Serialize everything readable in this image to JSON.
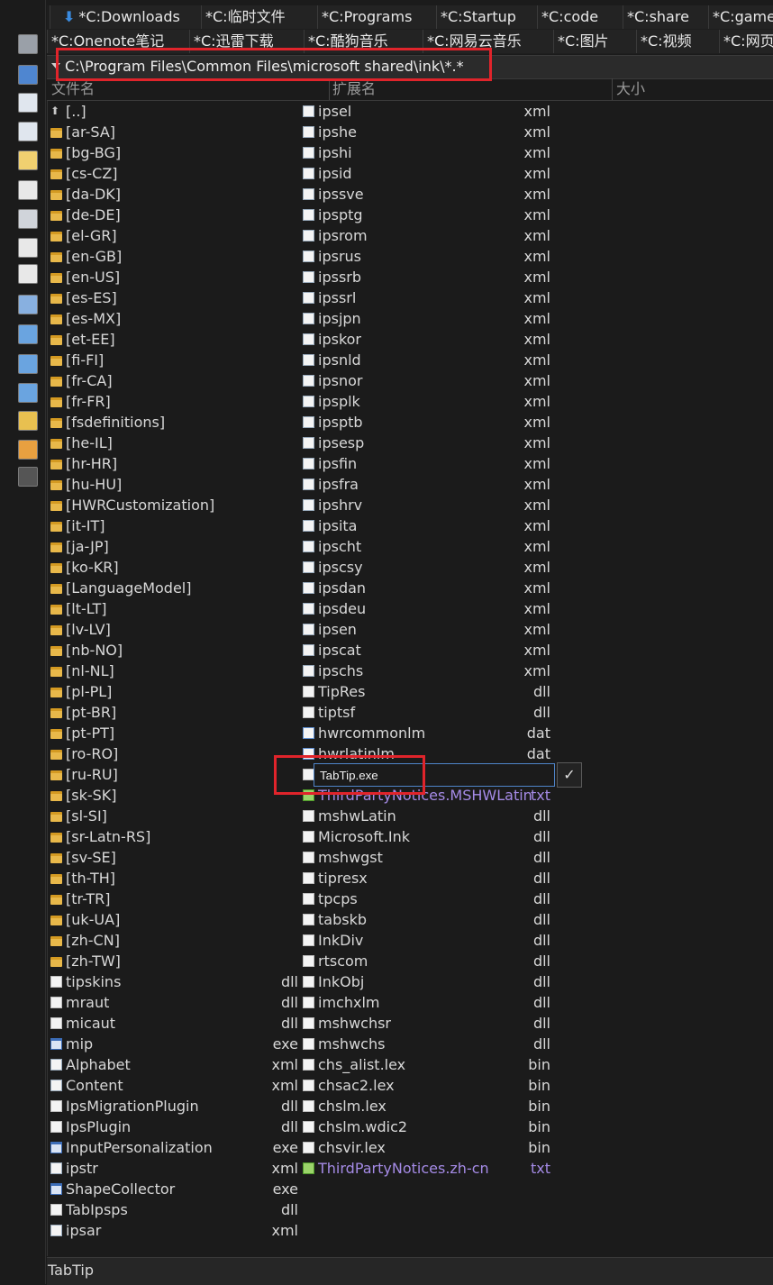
{
  "tabs_row1": [
    {
      "label": "*C:Downloads",
      "icon": "download-arrow-icon"
    },
    {
      "label": "*C:临时文件"
    },
    {
      "label": "*C:Programs"
    },
    {
      "label": "*C:Startup"
    },
    {
      "label": "*C:code"
    },
    {
      "label": "*C:share"
    },
    {
      "label": "*C:game"
    }
  ],
  "tabs_row2": [
    {
      "label": "*C:Onenote笔记"
    },
    {
      "label": "*C:迅雷下载"
    },
    {
      "label": "*C:酷狗音乐"
    },
    {
      "label": "*C:网易云音乐"
    },
    {
      "label": "*C:图片"
    },
    {
      "label": "*C:视频"
    },
    {
      "label": "*C:网页"
    }
  ],
  "path": "C:\\Program Files\\Common Files\\microsoft shared\\ink\\*.*",
  "columns": {
    "name": "文件名",
    "ext": "扩展名",
    "size": "大小"
  },
  "left_column": [
    {
      "name": "[..]",
      "ext": "",
      "icon": "up"
    },
    {
      "name": "[ar-SA]",
      "ext": "",
      "icon": "folder"
    },
    {
      "name": "[bg-BG]",
      "ext": "",
      "icon": "folder"
    },
    {
      "name": "[cs-CZ]",
      "ext": "",
      "icon": "folder"
    },
    {
      "name": "[da-DK]",
      "ext": "",
      "icon": "folder"
    },
    {
      "name": "[de-DE]",
      "ext": "",
      "icon": "folder"
    },
    {
      "name": "[el-GR]",
      "ext": "",
      "icon": "folder"
    },
    {
      "name": "[en-GB]",
      "ext": "",
      "icon": "folder"
    },
    {
      "name": "[en-US]",
      "ext": "",
      "icon": "folder"
    },
    {
      "name": "[es-ES]",
      "ext": "",
      "icon": "folder"
    },
    {
      "name": "[es-MX]",
      "ext": "",
      "icon": "folder"
    },
    {
      "name": "[et-EE]",
      "ext": "",
      "icon": "folder"
    },
    {
      "name": "[fi-FI]",
      "ext": "",
      "icon": "folder"
    },
    {
      "name": "[fr-CA]",
      "ext": "",
      "icon": "folder"
    },
    {
      "name": "[fr-FR]",
      "ext": "",
      "icon": "folder"
    },
    {
      "name": "[fsdefinitions]",
      "ext": "",
      "icon": "folder"
    },
    {
      "name": "[he-IL]",
      "ext": "",
      "icon": "folder"
    },
    {
      "name": "[hr-HR]",
      "ext": "",
      "icon": "folder"
    },
    {
      "name": "[hu-HU]",
      "ext": "",
      "icon": "folder"
    },
    {
      "name": "[HWRCustomization]",
      "ext": "",
      "icon": "folder"
    },
    {
      "name": "[it-IT]",
      "ext": "",
      "icon": "folder"
    },
    {
      "name": "[ja-JP]",
      "ext": "",
      "icon": "folder"
    },
    {
      "name": "[ko-KR]",
      "ext": "",
      "icon": "folder"
    },
    {
      "name": "[LanguageModel]",
      "ext": "",
      "icon": "folder"
    },
    {
      "name": "[lt-LT]",
      "ext": "",
      "icon": "folder"
    },
    {
      "name": "[lv-LV]",
      "ext": "",
      "icon": "folder"
    },
    {
      "name": "[nb-NO]",
      "ext": "",
      "icon": "folder"
    },
    {
      "name": "[nl-NL]",
      "ext": "",
      "icon": "folder"
    },
    {
      "name": "[pl-PL]",
      "ext": "",
      "icon": "folder"
    },
    {
      "name": "[pt-BR]",
      "ext": "",
      "icon": "folder"
    },
    {
      "name": "[pt-PT]",
      "ext": "",
      "icon": "folder"
    },
    {
      "name": "[ro-RO]",
      "ext": "",
      "icon": "folder"
    },
    {
      "name": "[ru-RU]",
      "ext": "",
      "icon": "folder"
    },
    {
      "name": "[sk-SK]",
      "ext": "",
      "icon": "folder"
    },
    {
      "name": "[sl-SI]",
      "ext": "",
      "icon": "folder"
    },
    {
      "name": "[sr-Latn-RS]",
      "ext": "",
      "icon": "folder"
    },
    {
      "name": "[sv-SE]",
      "ext": "",
      "icon": "folder"
    },
    {
      "name": "[th-TH]",
      "ext": "",
      "icon": "folder"
    },
    {
      "name": "[tr-TR]",
      "ext": "",
      "icon": "folder"
    },
    {
      "name": "[uk-UA]",
      "ext": "",
      "icon": "folder"
    },
    {
      "name": "[zh-CN]",
      "ext": "",
      "icon": "folder"
    },
    {
      "name": "[zh-TW]",
      "ext": "",
      "icon": "folder"
    },
    {
      "name": "tipskins",
      "ext": "dll",
      "icon": "file"
    },
    {
      "name": "mraut",
      "ext": "dll",
      "icon": "file"
    },
    {
      "name": "micaut",
      "ext": "dll",
      "icon": "file"
    },
    {
      "name": "mip",
      "ext": "exe",
      "icon": "exe"
    },
    {
      "name": "Alphabet",
      "ext": "xml",
      "icon": "xmlf"
    },
    {
      "name": "Content",
      "ext": "xml",
      "icon": "xmlf"
    },
    {
      "name": "IpsMigrationPlugin",
      "ext": "dll",
      "icon": "file"
    },
    {
      "name": "IpsPlugin",
      "ext": "dll",
      "icon": "file"
    },
    {
      "name": "InputPersonalization",
      "ext": "exe",
      "icon": "exe"
    },
    {
      "name": "ipstr",
      "ext": "xml",
      "icon": "xmlf"
    },
    {
      "name": "ShapeCollector",
      "ext": "exe",
      "icon": "exe"
    },
    {
      "name": "TabIpsps",
      "ext": "dll",
      "icon": "file"
    },
    {
      "name": "ipsar",
      "ext": "xml",
      "icon": "xmlf"
    }
  ],
  "right_column": [
    {
      "name": "ipsel",
      "ext": "xml",
      "icon": "xmlf"
    },
    {
      "name": "ipshe",
      "ext": "xml",
      "icon": "xmlf"
    },
    {
      "name": "ipshi",
      "ext": "xml",
      "icon": "xmlf"
    },
    {
      "name": "ipsid",
      "ext": "xml",
      "icon": "xmlf"
    },
    {
      "name": "ipssve",
      "ext": "xml",
      "icon": "xmlf"
    },
    {
      "name": "ipsptg",
      "ext": "xml",
      "icon": "xmlf"
    },
    {
      "name": "ipsrom",
      "ext": "xml",
      "icon": "xmlf"
    },
    {
      "name": "ipsrus",
      "ext": "xml",
      "icon": "xmlf"
    },
    {
      "name": "ipssrb",
      "ext": "xml",
      "icon": "xmlf"
    },
    {
      "name": "ipssrl",
      "ext": "xml",
      "icon": "xmlf"
    },
    {
      "name": "ipsjpn",
      "ext": "xml",
      "icon": "xmlf"
    },
    {
      "name": "ipskor",
      "ext": "xml",
      "icon": "xmlf"
    },
    {
      "name": "ipsnld",
      "ext": "xml",
      "icon": "xmlf"
    },
    {
      "name": "ipsnor",
      "ext": "xml",
      "icon": "xmlf"
    },
    {
      "name": "ipsplk",
      "ext": "xml",
      "icon": "xmlf"
    },
    {
      "name": "ipsptb",
      "ext": "xml",
      "icon": "xmlf"
    },
    {
      "name": "ipsesp",
      "ext": "xml",
      "icon": "xmlf"
    },
    {
      "name": "ipsfin",
      "ext": "xml",
      "icon": "xmlf"
    },
    {
      "name": "ipsfra",
      "ext": "xml",
      "icon": "xmlf"
    },
    {
      "name": "ipshrv",
      "ext": "xml",
      "icon": "xmlf"
    },
    {
      "name": "ipsita",
      "ext": "xml",
      "icon": "xmlf"
    },
    {
      "name": "ipscht",
      "ext": "xml",
      "icon": "xmlf"
    },
    {
      "name": "ipscsy",
      "ext": "xml",
      "icon": "xmlf"
    },
    {
      "name": "ipsdan",
      "ext": "xml",
      "icon": "xmlf"
    },
    {
      "name": "ipsdeu",
      "ext": "xml",
      "icon": "xmlf"
    },
    {
      "name": "ipsen",
      "ext": "xml",
      "icon": "xmlf"
    },
    {
      "name": "ipscat",
      "ext": "xml",
      "icon": "xmlf"
    },
    {
      "name": "ipschs",
      "ext": "xml",
      "icon": "xmlf"
    },
    {
      "name": "TipRes",
      "ext": "dll",
      "icon": "file"
    },
    {
      "name": "tiptsf",
      "ext": "dll",
      "icon": "file"
    },
    {
      "name": "hwrcommonlm",
      "ext": "dat",
      "icon": "file-blue"
    },
    {
      "name": "hwrlatinlm",
      "ext": "dat",
      "icon": "file-blue"
    },
    {
      "name": "",
      "ext": "",
      "icon": "file",
      "renaming": true
    },
    {
      "name": "ThirdPartyNotices.MSHWLatin",
      "ext": "txt",
      "icon": "txt",
      "notice": true
    },
    {
      "name": "mshwLatin",
      "ext": "dll",
      "icon": "file"
    },
    {
      "name": "Microsoft.Ink",
      "ext": "dll",
      "icon": "file"
    },
    {
      "name": "mshwgst",
      "ext": "dll",
      "icon": "file"
    },
    {
      "name": "tipresx",
      "ext": "dll",
      "icon": "file"
    },
    {
      "name": "tpcps",
      "ext": "dll",
      "icon": "file"
    },
    {
      "name": "tabskb",
      "ext": "dll",
      "icon": "file"
    },
    {
      "name": "InkDiv",
      "ext": "dll",
      "icon": "file"
    },
    {
      "name": "rtscom",
      "ext": "dll",
      "icon": "file"
    },
    {
      "name": "InkObj",
      "ext": "dll",
      "icon": "file"
    },
    {
      "name": "imchxlm",
      "ext": "dll",
      "icon": "file"
    },
    {
      "name": "mshwchsr",
      "ext": "dll",
      "icon": "file"
    },
    {
      "name": "mshwchs",
      "ext": "dll",
      "icon": "file"
    },
    {
      "name": "chs_alist.lex",
      "ext": "bin",
      "icon": "file"
    },
    {
      "name": "chsac2.lex",
      "ext": "bin",
      "icon": "file"
    },
    {
      "name": "chslm.lex",
      "ext": "bin",
      "icon": "file"
    },
    {
      "name": "chslm.wdic2",
      "ext": "bin",
      "icon": "file"
    },
    {
      "name": "chsvir.lex",
      "ext": "bin",
      "icon": "file"
    },
    {
      "name": "ThirdPartyNotices.zh-cn",
      "ext": "txt",
      "icon": "txt",
      "notice": true
    }
  ],
  "rename": {
    "value": "TabTip.exe",
    "confirm_icon": "check-icon",
    "confirm_glyph": "✓"
  },
  "status": "TabTip",
  "colors": {
    "highlight_red": "#e0242b",
    "notice_purple": "#a58be6",
    "folder": "#e8b84a",
    "accent_blue": "#3a8be0"
  },
  "toolbar_icons": [
    "up-arrow-icon",
    "search-icon",
    "edit-icon",
    "copy-icon",
    "move-icon",
    "new-folder-icon",
    "delete-icon",
    "settings-icon",
    "file-icon",
    "print-icon",
    "tree-icon",
    "list-icon",
    "sync-icon",
    "folder-sync-icon",
    "filter-icon",
    "filter-active-icon"
  ]
}
